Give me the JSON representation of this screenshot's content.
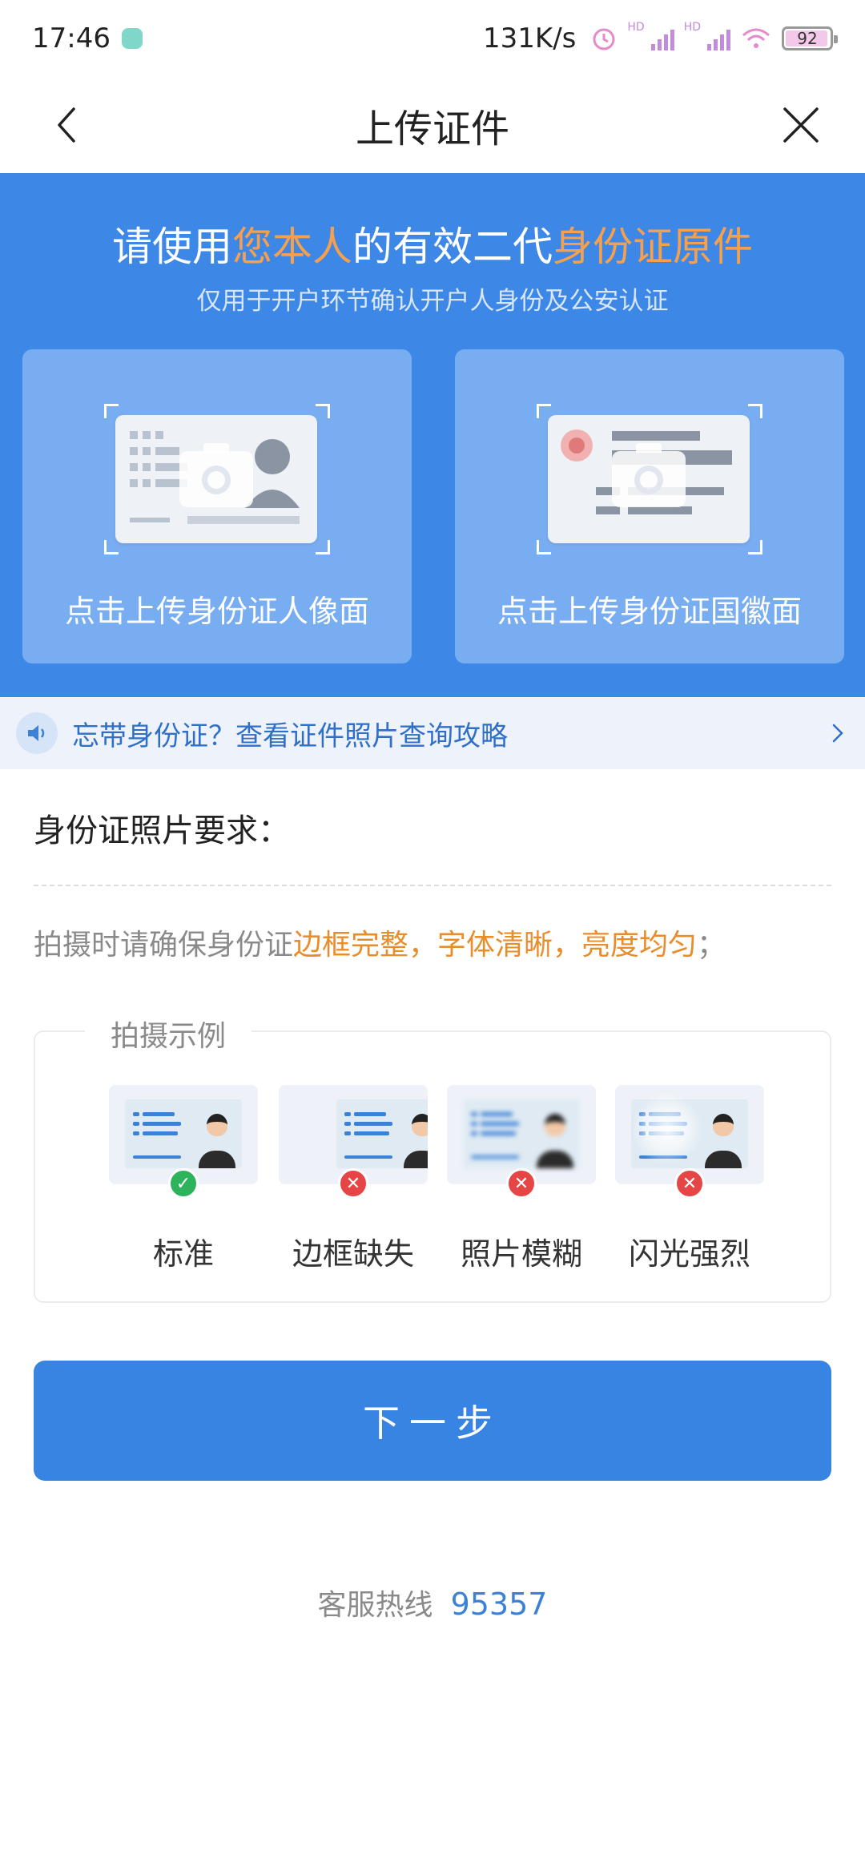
{
  "status_bar": {
    "time": "17:46",
    "network_speed": "131K/s",
    "signal_tag": "HD",
    "battery": "92"
  },
  "nav": {
    "title": "上传证件"
  },
  "banner": {
    "title_part1": "请使用",
    "title_hl1": "您本人",
    "title_part2": "的有效二代",
    "title_hl2": "身份证原件",
    "subtitle": "仅用于开户环节确认开户人身份及公安认证",
    "front_label": "点击上传身份证人像面",
    "back_label": "点击上传身份证国徽面"
  },
  "tip": {
    "text": "忘带身份证？查看证件照片查询攻略"
  },
  "requirements": {
    "title": "身份证照片要求：",
    "text_prefix": "拍摄时请确保身份证",
    "text_emphasis": "边框完整，字体清晰，亮度均匀",
    "text_suffix": "；"
  },
  "example": {
    "legend": "拍摄示例",
    "items": [
      {
        "label": "标准",
        "status": "ok"
      },
      {
        "label": "边框缺失",
        "status": "bad"
      },
      {
        "label": "照片模糊",
        "status": "bad"
      },
      {
        "label": "闪光强烈",
        "status": "bad"
      }
    ]
  },
  "next_button": {
    "label": "下一步"
  },
  "hotline": {
    "label": "客服热线",
    "number": "95357"
  },
  "colors": {
    "primary_blue": "#3d87e6",
    "highlight_orange": "#f6a04d",
    "ok_green": "#2db35b",
    "error_red": "#e64545"
  }
}
